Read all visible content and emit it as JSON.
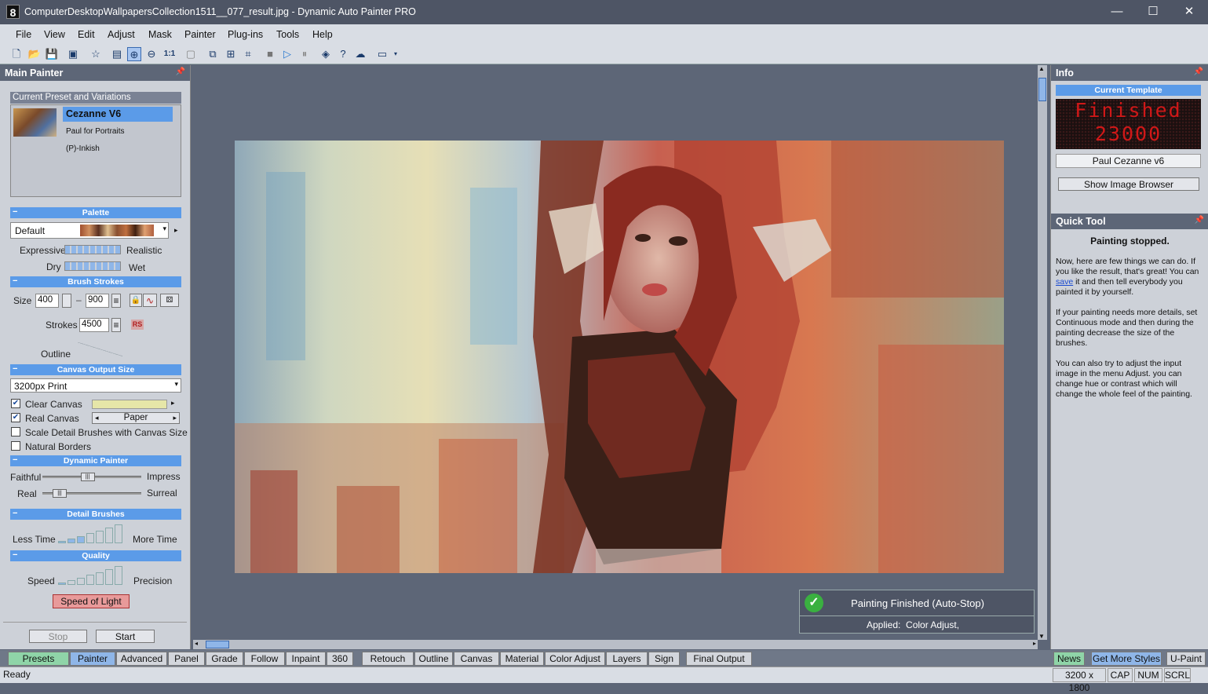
{
  "window": {
    "app_number": "8",
    "title": "ComputerDesktopWallpapersCollection1511__077_result.jpg - Dynamic Auto Painter PRO",
    "minimize": "—",
    "maximize": "☐",
    "close": "✕"
  },
  "menu": [
    "File",
    "View",
    "Edit",
    "Adjust",
    "Mask",
    "Painter",
    "Plug-ins",
    "Tools",
    "Help"
  ],
  "toolbar": {
    "zoom_label": "1:1"
  },
  "main_painter": {
    "title": "Main Painter",
    "preset_header": "Current Preset and Variations",
    "presets": [
      "Cezanne V6",
      "Paul for Portraits",
      "(P)-Inkish"
    ],
    "palette_section": "Palette",
    "palette_value": "Default",
    "expressive": "Expressive",
    "realistic": "Realistic",
    "dry": "Dry",
    "wet": "Wet",
    "brush_section": "Brush Strokes",
    "size_label": "Size",
    "size_min": "400",
    "size_max": "900",
    "strokes_label": "Strokes",
    "strokes_value": "4500",
    "rs_label": "RS",
    "outline_label": "Outline",
    "canvas_section": "Canvas Output Size",
    "canvas_value": "3200px Print",
    "clear_canvas": "Clear Canvas",
    "real_canvas": "Real Canvas",
    "paper": "Paper",
    "scale_detail": "Scale Detail Brushes with Canvas Size",
    "natural_borders": "Natural Borders",
    "dynamic_section": "Dynamic Painter",
    "faithful": "Faithful",
    "impress": "Impress",
    "real": "Real",
    "surreal": "Surreal",
    "faithful_level": 0.45,
    "real_level": 0.12,
    "detail_section": "Detail Brushes",
    "less_time": "Less Time",
    "more_time": "More Time",
    "quality_section": "Quality",
    "speed": "Speed",
    "precision": "Precision",
    "speed_of_light": "Speed of Light",
    "stop": "Stop",
    "start": "Start"
  },
  "info": {
    "title": "Info",
    "current_template": "Current Template",
    "led_line1": "Finished",
    "led_line2": "23000",
    "template_name": "Paul Cezanne v6",
    "show_browser": "Show Image Browser"
  },
  "quick_tool": {
    "title": "Quick Tool",
    "heading": "Painting stopped.",
    "p1a": "Now, here are few things we can do. If you like the result, that's great! You can ",
    "p1link": "save",
    "p1b": " it and then tell everybody you painted it by yourself.",
    "p2": "If your painting needs more details, set Continuous mode and then during the painting decrease the size of the brushes.",
    "p3": "You can also try to adjust the input image in the menu Adjust. you can change hue or contrast which will change the whole feel of the painting."
  },
  "notification": {
    "title": "Painting Finished (Auto-Stop)",
    "applied_label": "Applied:",
    "applied_value": "Color Adjust,"
  },
  "tabs": [
    "Presets",
    "Painter",
    "Advanced",
    "Panel",
    "Grade",
    "Follow",
    "Inpaint",
    "360",
    "Retouch",
    "Outline",
    "Canvas",
    "Material",
    "Color Adjust",
    "Layers",
    "Sign",
    "Final Output"
  ],
  "right_tabs": [
    "News",
    "Get More Styles",
    "U-Paint"
  ],
  "status": {
    "text": "Ready",
    "dims": "3200 x 1800",
    "cap": "CAP",
    "num": "NUM",
    "scrl": "SCRL"
  },
  "colors": {
    "accent": "#5b9be8",
    "frame": "#5d6677",
    "led": "#d01818"
  }
}
